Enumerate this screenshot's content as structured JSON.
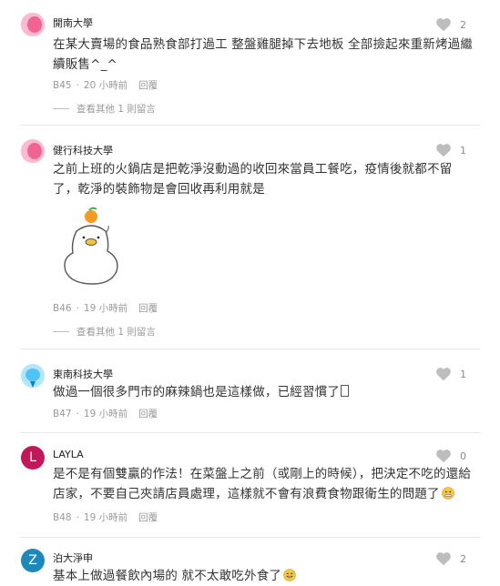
{
  "comments": [
    {
      "author": "開南大學",
      "likes": "2",
      "text": "在某大賣場的食品熟食部打過工 整盤雞腿掉下去地板 全部撿起來重新烤過繼續販售^_^",
      "floor": "B45",
      "time": "20 小時前",
      "reply": "回覆",
      "more": "查看其他 1 則留言",
      "avatar": "pink-face-icon"
    },
    {
      "author": "健行科技大學",
      "likes": "1",
      "text": "之前上班的火鍋店是把乾淨沒動過的收回來當員工餐吃，疫情後就都不留了，乾淨的裝飾物是會回收再利用就是",
      "floor": "B46",
      "time": "19 小時前",
      "reply": "回覆",
      "more": "查看其他 1 則留言",
      "avatar": "pink-face-icon"
    },
    {
      "author": "東南科技大學",
      "likes": "1",
      "text": "做過一個很多門市的麻辣鍋也是這樣做，已經習慣了",
      "floor": "B47",
      "time": "19 小時前",
      "reply": "回覆",
      "avatar": "blue-face-icon"
    },
    {
      "author": "LAYLA",
      "likes": "0",
      "text": "是不是有個雙贏的作法！在菜盤上之前（或剛上的時候），把決定不吃的還給店家，不要自己夾請店員處理，這樣就不會有浪費食物跟衛生的問題了",
      "floor": "B48",
      "time": "19 小時前",
      "reply": "回覆",
      "avatar_letter": "L",
      "avatar_color": "#c2185b"
    },
    {
      "author": "泊大淨申",
      "likes": "2",
      "text": "基本上做過餐飲內場的 就不太敢吃外食了",
      "avatar_letter": "Z",
      "avatar_color": "#1e88b8"
    }
  ]
}
